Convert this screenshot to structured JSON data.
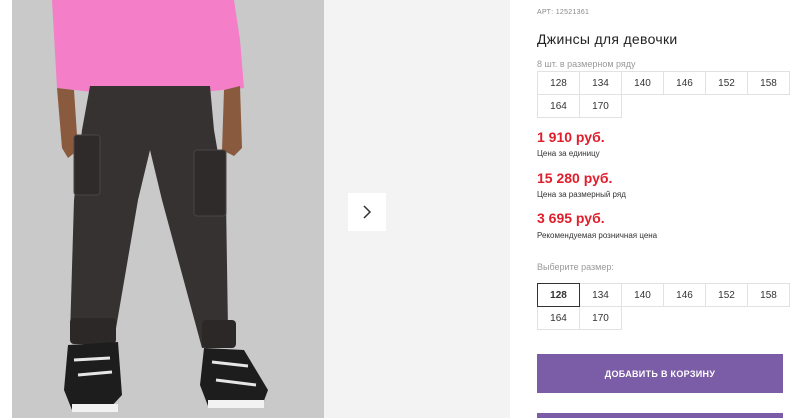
{
  "product": {
    "sku": "АРТ: 12521361",
    "title": "Джинсы для девочки",
    "size_row_note": "8 шт. в размерном ряду",
    "size_row": [
      "128",
      "134",
      "140",
      "146",
      "152",
      "158",
      "164",
      "170"
    ],
    "prices": [
      {
        "value": "1 910 руб.",
        "label": "Цена за единицу"
      },
      {
        "value": "15 280 руб.",
        "label": "Цена за размерный ряд"
      },
      {
        "value": "3 695 руб.",
        "label": "Рекомендуемая розничная цена"
      }
    ],
    "choose_size_label": "Выберите размер:",
    "sizes": [
      "128",
      "134",
      "140",
      "146",
      "152",
      "158",
      "164",
      "170"
    ],
    "selected_size": "128",
    "add_to_cart_label": "ДОБАВИТЬ В КОРЗИНУ"
  },
  "colors": {
    "price_red": "#e01d2b",
    "button_purple": "#7b5ca7",
    "shirt_pink": "#f47ec8",
    "jeans_dark": "#363232"
  },
  "icons": {
    "next_arrow": "chevron-right-icon"
  }
}
